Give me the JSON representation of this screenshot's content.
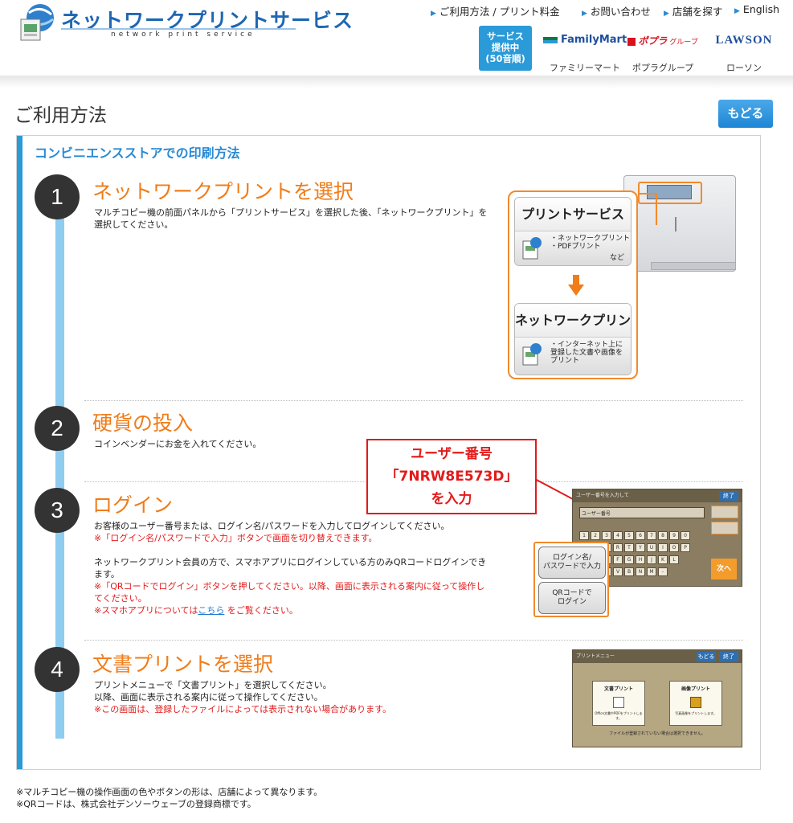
{
  "header": {
    "logo_title": "ネットワークプリントサービス",
    "logo_subtitle": "network print service",
    "nav": [
      {
        "label": "ご利用方法 / プリント料金"
      },
      {
        "label": "お問い合わせ"
      },
      {
        "label": "店舗を探す"
      },
      {
        "label": "English"
      }
    ],
    "service_badge": [
      "サービス",
      "提供中",
      "(50音順)"
    ],
    "stores": [
      {
        "logo": "FamilyMart",
        "name": "ファミリーマート",
        "color": "#0f7a3a"
      },
      {
        "logo": "ポプラ",
        "logo_suffix": "グループ",
        "name": "ポプラグループ",
        "color": "#d9121e"
      },
      {
        "logo": "LAWSON",
        "name": "ローソン",
        "color": "#1f4f9c"
      }
    ]
  },
  "page": {
    "title": "ご利用方法",
    "back_button": "もどる"
  },
  "panel": {
    "heading": "コンビニエンスストアでの印刷方法",
    "steps": [
      {
        "number": "1",
        "title": "ネットワークプリントを選択",
        "text": "マルチコピー機の前面パネルから「プリントサービス」を選択した後、「ネットワークプリント」を選択してください。"
      },
      {
        "number": "2",
        "title": "硬貨の投入",
        "text": "コインベンダーにお金を入れてください。"
      },
      {
        "number": "3",
        "title": "ログイン",
        "text": "お客様のユーザー番号または、ログイン名/パスワードを入力してログインしてください。",
        "note1": "※「ログイン名/パスワードで入力」ボタンで画面を切り替えできます。",
        "text2": "ネットワークプリント会員の方で、スマホアプリにログインしている方のみQRコードログインできます。",
        "note2": "※「QRコードでログイン」ボタンを押してください。以降、画面に表示される案内に従って操作してください。",
        "note3_pre": "※スマホアプリについては",
        "note3_link": "こちら",
        "note3_post": " をご覧ください。"
      },
      {
        "number": "4",
        "title": "文書プリントを選択",
        "text": "プリントメニューで「文書プリント」を選択してください。",
        "text2": "以降、画面に表示される案内に従って操作してください。",
        "note1": "※この画面は、登録したファイルによっては表示されない場合があります。"
      }
    ]
  },
  "illustration_step1": {
    "box1_title": "プリントサービス",
    "box1_lines": [
      "・ネットワークプリント",
      "・PDFプリント"
    ],
    "box1_more": "など",
    "box2_title": "ネットワークプリント",
    "box2_lines": [
      "・インターネット上に",
      "登録した文書や画像を",
      "プリント"
    ]
  },
  "illustration_step3": {
    "callout": [
      "ユーザー番号",
      "「7NRW8E573D」",
      "を入力"
    ],
    "kb_top": "ユーザー番号を入力して",
    "kb_end": "終了",
    "kb_input_label": "ユーザー番号",
    "kb_next": "次へ",
    "btn_login_name": [
      "ログイン名/",
      "パスワードで入力"
    ],
    "btn_qr": [
      "QRコードで",
      "ログイン"
    ]
  },
  "illustration_step4": {
    "top": "プリントメニュー",
    "back": "もどる",
    "end": "終了",
    "card1_title": "文書プリント",
    "card2_title": "画像プリント",
    "card1_sub": "Office文書やPDFをプリントします。",
    "card2_sub": "写真画像をプリントします。",
    "note": "ファイルが登録されていない場合は選択できません。"
  },
  "footer": {
    "notes": [
      "※マルチコピー機の操作画面の色やボタンの形は、店舗によって異なります。",
      "※QRコードは、株式会社デンソーウェーブの登録商標です。"
    ]
  },
  "colors": {
    "accent_blue": "#2a9ad8",
    "step_orange": "#f07c1a",
    "note_red": "#e21a1a"
  }
}
